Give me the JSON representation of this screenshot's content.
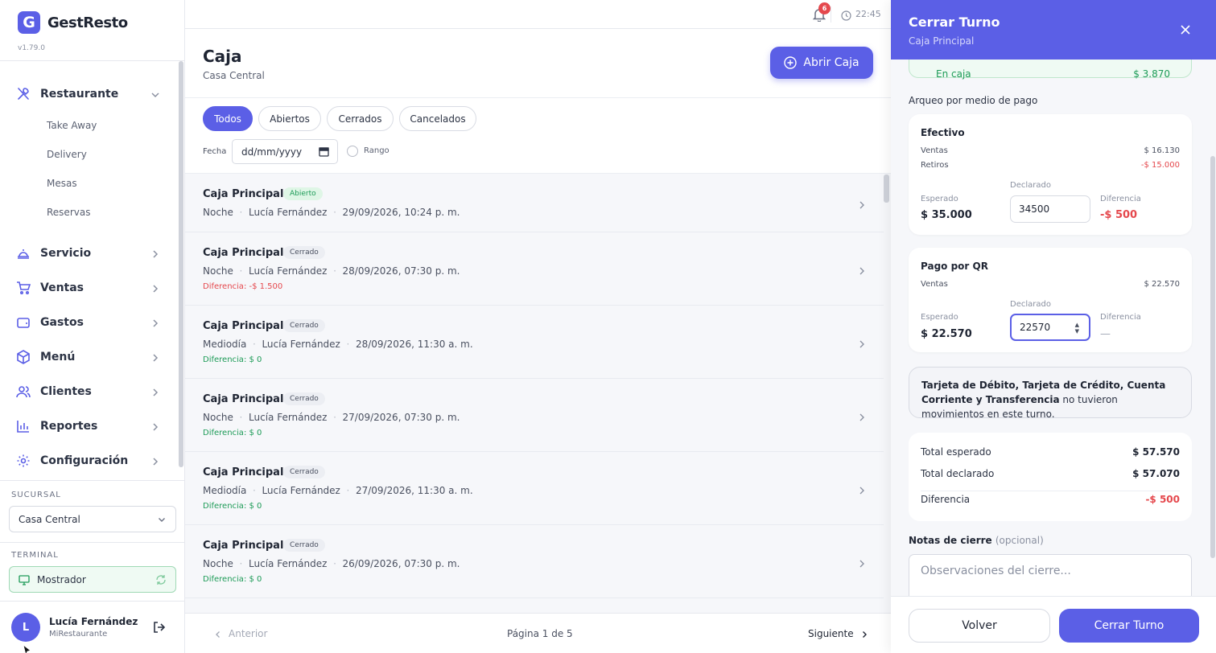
{
  "app": {
    "name": "GestResto",
    "logo_letter": "G",
    "version": "v1.79.0",
    "accent": "#5b5fe6"
  },
  "sidebar": {
    "restaurante": {
      "label": "Restaurante",
      "icon": "utensils-icon",
      "items": [
        "Take Away",
        "Delivery",
        "Mesas",
        "Reservas"
      ]
    },
    "nav": [
      {
        "label": "Servicio",
        "icon": "cloche-icon"
      },
      {
        "label": "Ventas",
        "icon": "cart-icon"
      },
      {
        "label": "Gastos",
        "icon": "wallet-icon"
      },
      {
        "label": "Menú",
        "icon": "box-icon"
      },
      {
        "label": "Clientes",
        "icon": "users-icon"
      },
      {
        "label": "Reportes",
        "icon": "bar-chart-icon"
      },
      {
        "label": "Configuración",
        "icon": "gear-icon"
      }
    ],
    "sucursal_label": "SUCURSAL",
    "sucursal_value": "Casa Central",
    "terminal_label": "TERMINAL",
    "terminal_value": "Mostrador",
    "user": {
      "initial": "L",
      "name": "Lucía Fernández",
      "org": "MiRestaurante"
    }
  },
  "topbar": {
    "notifications": "6",
    "time": "22:45"
  },
  "page": {
    "title": "Caja",
    "subtitle": "Casa Central",
    "open_button": "Abrir Caja"
  },
  "filters": {
    "chips": [
      "Todos",
      "Abiertos",
      "Cerrados",
      "Cancelados"
    ],
    "active": "Todos",
    "date_label": "Fecha",
    "date_placeholder": "dd/mm/yyyy",
    "range_label": "Rango"
  },
  "rows": [
    {
      "title": "Caja Principal",
      "status": "Abierto",
      "shift": "Noche",
      "user": "Lucía Fernández",
      "datetime": "29/09/2026, 10:24 p. m.",
      "diff": ""
    },
    {
      "title": "Caja Principal",
      "status": "Cerrado",
      "shift": "Noche",
      "user": "Lucía Fernández",
      "datetime": "28/09/2026, 07:30 p. m.",
      "diff": "Diferencia: -$ 1.500"
    },
    {
      "title": "Caja Principal",
      "status": "Cerrado",
      "shift": "Mediodía",
      "user": "Lucía Fernández",
      "datetime": "28/09/2026, 11:30 a. m.",
      "diff": "Diferencia: $ 0"
    },
    {
      "title": "Caja Principal",
      "status": "Cerrado",
      "shift": "Noche",
      "user": "Lucía Fernández",
      "datetime": "27/09/2026, 07:30 p. m.",
      "diff": "Diferencia: $ 0"
    },
    {
      "title": "Caja Principal",
      "status": "Cerrado",
      "shift": "Mediodía",
      "user": "Lucía Fernández",
      "datetime": "27/09/2026, 11:30 a. m.",
      "diff": "Diferencia: $ 0"
    },
    {
      "title": "Caja Principal",
      "status": "Cerrado",
      "shift": "Noche",
      "user": "Lucía Fernández",
      "datetime": "26/09/2026, 07:30 p. m.",
      "diff": "Diferencia: $ 0"
    }
  ],
  "pagination": {
    "prev": "Anterior",
    "info": "Página 1 de 5",
    "next": "Siguiente"
  },
  "drawer": {
    "title": "Cerrar Turno",
    "subtitle": "Caja Principal",
    "en_caja_label": "En caja",
    "en_caja_value": "$ 3.870",
    "arqueo_label": "Arqueo por medio de pago",
    "efectivo": {
      "title": "Efectivo",
      "ventas_label": "Ventas",
      "ventas_value": "$ 16.130",
      "retiros_label": "Retiros",
      "retiros_value": "-$ 15.000",
      "esperado_label": "Esperado",
      "esperado_value": "$ 35.000",
      "declarado_label": "Declarado",
      "declarado_value": "34500",
      "diferencia_label": "Diferencia",
      "diferencia_value": "-$ 500"
    },
    "qr": {
      "title": "Pago por QR",
      "ventas_label": "Ventas",
      "ventas_value": "$ 22.570",
      "esperado_label": "Esperado",
      "esperado_value": "$ 22.570",
      "declarado_label": "Declarado",
      "declarado_value": "22570",
      "diferencia_label": "Diferencia",
      "diferencia_value": "—"
    },
    "note_bold": "Tarjeta de Débito, Tarjeta de Crédito, Cuenta Corriente y Transferencia",
    "note_rest": " no tuvieron movimientos en este turno.",
    "totals": {
      "esperado_label": "Total esperado",
      "esperado_value": "$ 57.570",
      "declarado_label": "Total declarado",
      "declarado_value": "$ 57.070",
      "diferencia_label": "Diferencia",
      "diferencia_value": "-$ 500"
    },
    "notes_label": "Notas de cierre",
    "notes_optional": "(opcional)",
    "notes_placeholder": "Observaciones del cierre...",
    "back_button": "Volver",
    "close_button": "Cerrar Turno"
  }
}
